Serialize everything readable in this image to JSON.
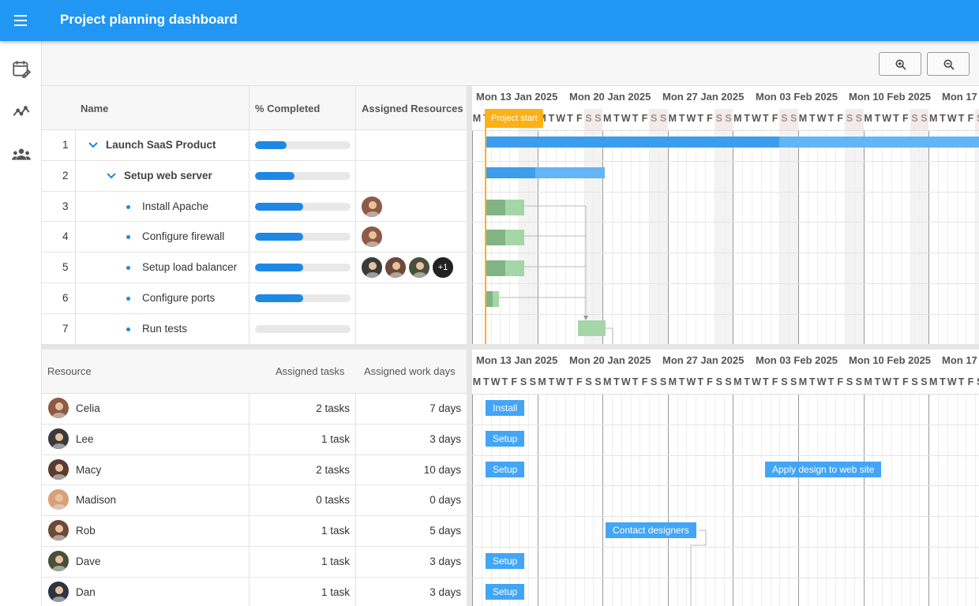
{
  "app": {
    "title": "Project planning dashboard"
  },
  "colors": {
    "primary": "#2196f3",
    "progress": "#1e88e5",
    "milestone": "#fbb117",
    "event": "#42a5f5"
  },
  "nav": {
    "items": [
      {
        "icon": "calendar-edit-icon"
      },
      {
        "icon": "trending-icon"
      },
      {
        "icon": "people-icon"
      }
    ]
  },
  "toolbar": {
    "zoom_in_icon": "zoom-in-icon",
    "zoom_out_icon": "zoom-out-icon"
  },
  "tasks": {
    "columns": {
      "name": "Name",
      "completed": "% Completed",
      "resources": "Assigned Resources"
    },
    "rows": [
      {
        "num": "1",
        "name": "Launch SaaS Product",
        "level": 0,
        "expander": "chevron",
        "progress": 0.33,
        "avatars": []
      },
      {
        "num": "2",
        "name": "Setup web server",
        "level": 1,
        "expander": "chevron",
        "progress": 0.41,
        "avatars": []
      },
      {
        "num": "3",
        "name": "Install Apache",
        "level": 2,
        "expander": "dot",
        "progress": 0.5,
        "avatars": [
          "Celia"
        ]
      },
      {
        "num": "4",
        "name": "Configure firewall",
        "level": 2,
        "expander": "dot",
        "progress": 0.5,
        "avatars": [
          "Celia"
        ]
      },
      {
        "num": "5",
        "name": "Setup load balancer",
        "level": 2,
        "expander": "dot",
        "progress": 0.5,
        "avatars": [
          "Lee",
          "Rob",
          "Dave",
          "+1"
        ]
      },
      {
        "num": "6",
        "name": "Configure ports",
        "level": 2,
        "expander": "dot",
        "progress": 0.5,
        "avatars": []
      },
      {
        "num": "7",
        "name": "Run tests",
        "level": 2,
        "expander": "dot",
        "progress": 0,
        "avatars": []
      }
    ]
  },
  "timeline": {
    "weeks": [
      "Mon 13 Jan 2025",
      "Mon 20 Jan 2025",
      "Mon 27 Jan 2025",
      "Mon 03 Feb 2025",
      "Mon 10 Feb 2025",
      "Mon 17"
    ],
    "day_letters": [
      "M",
      "T",
      "W",
      "T",
      "F",
      "S",
      "S"
    ],
    "milestone": "Project start"
  },
  "resources": {
    "columns": {
      "resource": "Resource",
      "tasks": "Assigned tasks",
      "days": "Assigned work days"
    },
    "rows": [
      {
        "name": "Celia",
        "tasks": "2 tasks",
        "days": "7 days"
      },
      {
        "name": "Lee",
        "tasks": "1 task",
        "days": "3 days"
      },
      {
        "name": "Macy",
        "tasks": "2 tasks",
        "days": "10 days"
      },
      {
        "name": "Madison",
        "tasks": "0 tasks",
        "days": "0 days"
      },
      {
        "name": "Rob",
        "tasks": "1 task",
        "days": "5 days"
      },
      {
        "name": "Dave",
        "tasks": "1 task",
        "days": "3 days"
      },
      {
        "name": "Dan",
        "tasks": "1 task",
        "days": "3 days"
      }
    ]
  },
  "events": [
    {
      "label": "Install",
      "row": 0
    },
    {
      "label": "Setup",
      "row": 1
    },
    {
      "label": "Setup",
      "row": 2
    },
    {
      "label": "Apply design to web site",
      "row": 2
    },
    {
      "label": "Contact designers",
      "row": 4
    },
    {
      "label": "Setup",
      "row": 5
    },
    {
      "label": "Setup",
      "row": 6
    }
  ]
}
